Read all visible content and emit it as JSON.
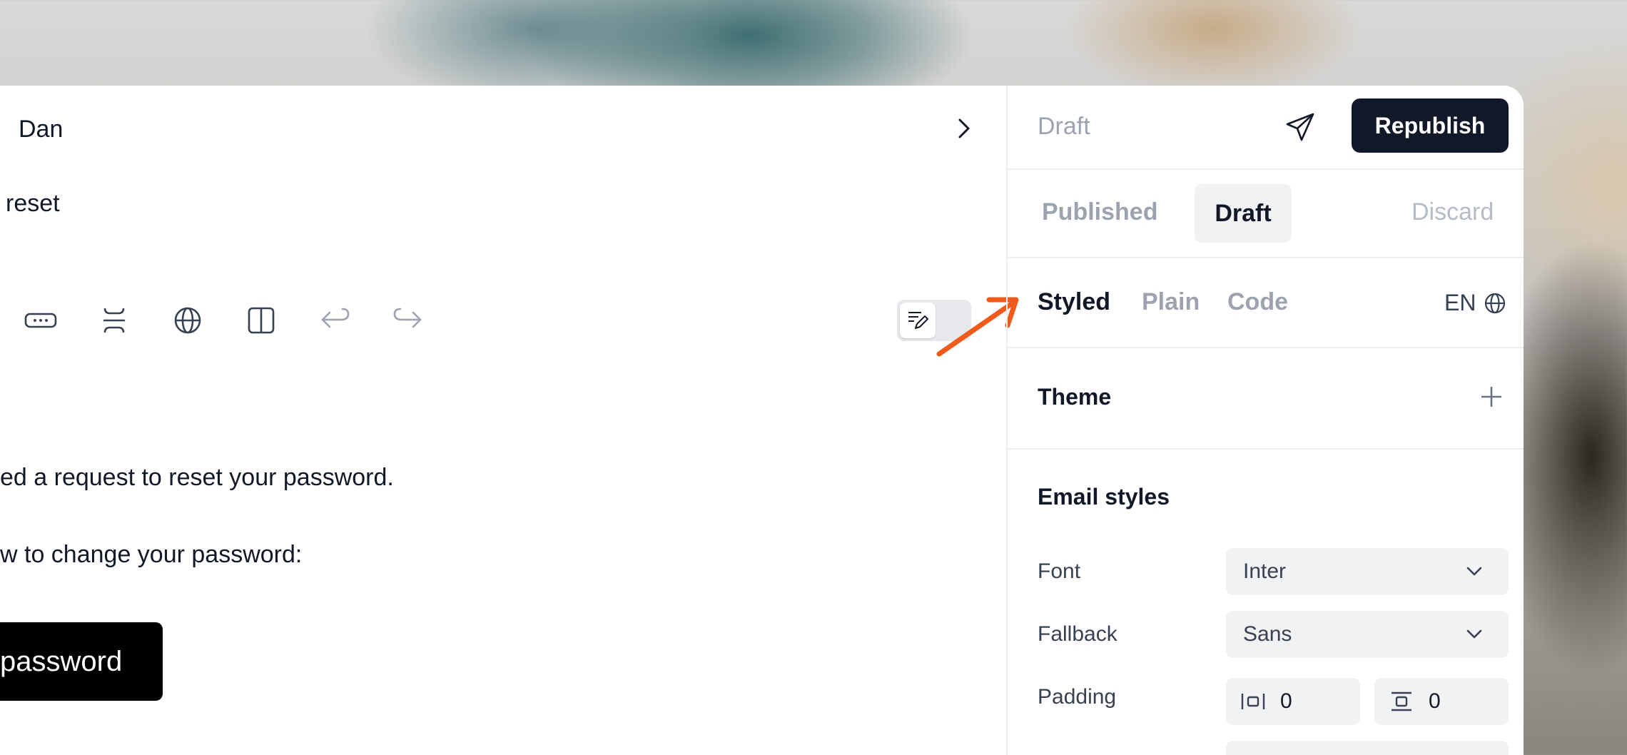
{
  "editor": {
    "to": "Dan",
    "subject": "reset",
    "body": {
      "line1": "ed a request to reset your password.",
      "line2": "w to change your password:",
      "button": "password"
    }
  },
  "sidebar": {
    "status": "Draft",
    "republish": "Republish",
    "versions": {
      "published": "Published",
      "draft": "Draft",
      "discard": "Discard"
    },
    "modes": {
      "styled": "Styled",
      "plain": "Plain",
      "code": "Code"
    },
    "language": "EN",
    "theme": "Theme",
    "email_styles": {
      "title": "Email styles",
      "font_label": "Font",
      "font_value": "Inter",
      "fallback_label": "Fallback",
      "fallback_value": "Sans",
      "padding_label": "Padding",
      "padding_horizontal": "0",
      "padding_vertical": "0"
    }
  },
  "colors": {
    "accent": "#111827",
    "annotation": "#F05A1A"
  }
}
